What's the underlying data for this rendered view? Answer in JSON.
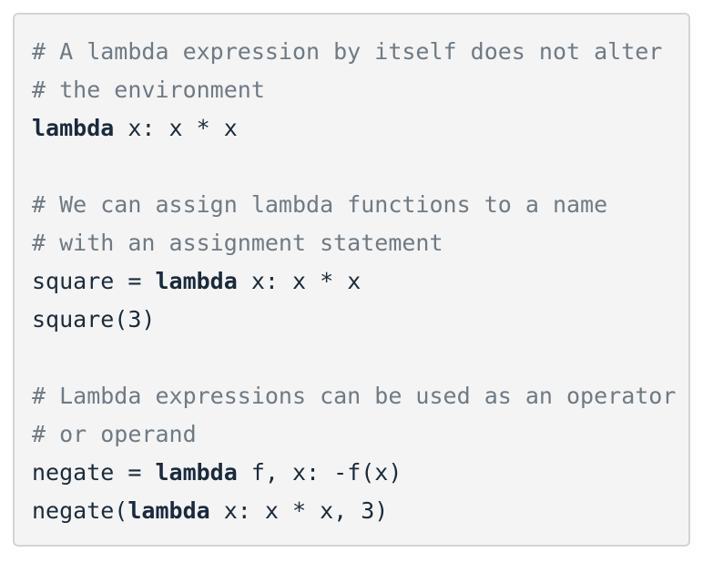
{
  "code": {
    "lines": [
      {
        "segments": [
          {
            "t": "comment",
            "text": "# A lambda expression by itself does not alter"
          }
        ]
      },
      {
        "segments": [
          {
            "t": "comment",
            "text": "# the environment"
          }
        ]
      },
      {
        "segments": [
          {
            "t": "kw",
            "text": "lambda"
          },
          {
            "t": "plain",
            "text": " x: x * x"
          }
        ]
      },
      {
        "segments": []
      },
      {
        "segments": [
          {
            "t": "comment",
            "text": "# We can assign lambda functions to a name"
          }
        ]
      },
      {
        "segments": [
          {
            "t": "comment",
            "text": "# with an assignment statement"
          }
        ]
      },
      {
        "segments": [
          {
            "t": "plain",
            "text": "square = "
          },
          {
            "t": "kw",
            "text": "lambda"
          },
          {
            "t": "plain",
            "text": " x: x * x"
          }
        ]
      },
      {
        "segments": [
          {
            "t": "plain",
            "text": "square(3)"
          }
        ]
      },
      {
        "segments": []
      },
      {
        "segments": [
          {
            "t": "comment",
            "text": "# Lambda expressions can be used as an operator"
          }
        ]
      },
      {
        "segments": [
          {
            "t": "comment",
            "text": "# or operand"
          }
        ]
      },
      {
        "segments": [
          {
            "t": "plain",
            "text": "negate = "
          },
          {
            "t": "kw",
            "text": "lambda"
          },
          {
            "t": "plain",
            "text": " f, x: -f(x)"
          }
        ]
      },
      {
        "segments": [
          {
            "t": "plain",
            "text": "negate("
          },
          {
            "t": "kw",
            "text": "lambda"
          },
          {
            "t": "plain",
            "text": " x: x * x, 3)"
          }
        ]
      }
    ]
  },
  "colors": {
    "panel_background": "#f4f4f4",
    "panel_border": "#d4d4d4",
    "comment": "#6f7a84",
    "keyword": "#1a2a3c",
    "text": "#1b2b3a"
  }
}
